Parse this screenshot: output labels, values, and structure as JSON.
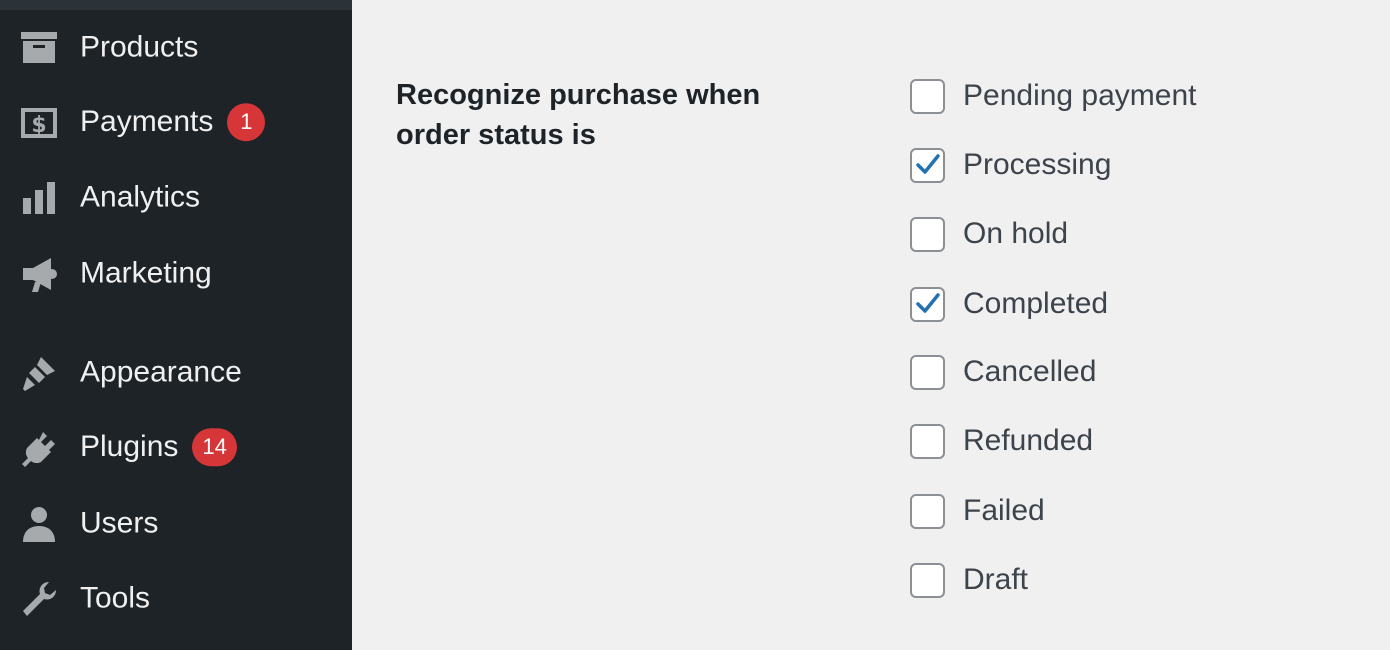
{
  "sidebar": {
    "items": [
      {
        "label": "Products",
        "icon": "archive-icon",
        "badge": null
      },
      {
        "label": "Payments",
        "icon": "money-icon",
        "badge": "1"
      },
      {
        "label": "Analytics",
        "icon": "bar-chart-icon",
        "badge": null
      },
      {
        "label": "Marketing",
        "icon": "megaphone-icon",
        "badge": null
      },
      {
        "label": "Appearance",
        "icon": "paintbrush-icon",
        "badge": null
      },
      {
        "label": "Plugins",
        "icon": "plug-icon",
        "badge": "14"
      },
      {
        "label": "Users",
        "icon": "user-icon",
        "badge": null
      },
      {
        "label": "Tools",
        "icon": "wrench-icon",
        "badge": null
      }
    ]
  },
  "setting": {
    "label": "Recognize purchase when order status is",
    "options": [
      {
        "label": "Pending payment",
        "checked": false
      },
      {
        "label": "Processing",
        "checked": true
      },
      {
        "label": "On hold",
        "checked": false
      },
      {
        "label": "Completed",
        "checked": true
      },
      {
        "label": "Cancelled",
        "checked": false
      },
      {
        "label": "Refunded",
        "checked": false
      },
      {
        "label": "Failed",
        "checked": false
      },
      {
        "label": "Draft",
        "checked": false
      }
    ]
  },
  "colors": {
    "sidebar_bg": "#1d2327",
    "content_bg": "#f0f0f1",
    "badge": "#d63638",
    "check": "#2271b1"
  }
}
